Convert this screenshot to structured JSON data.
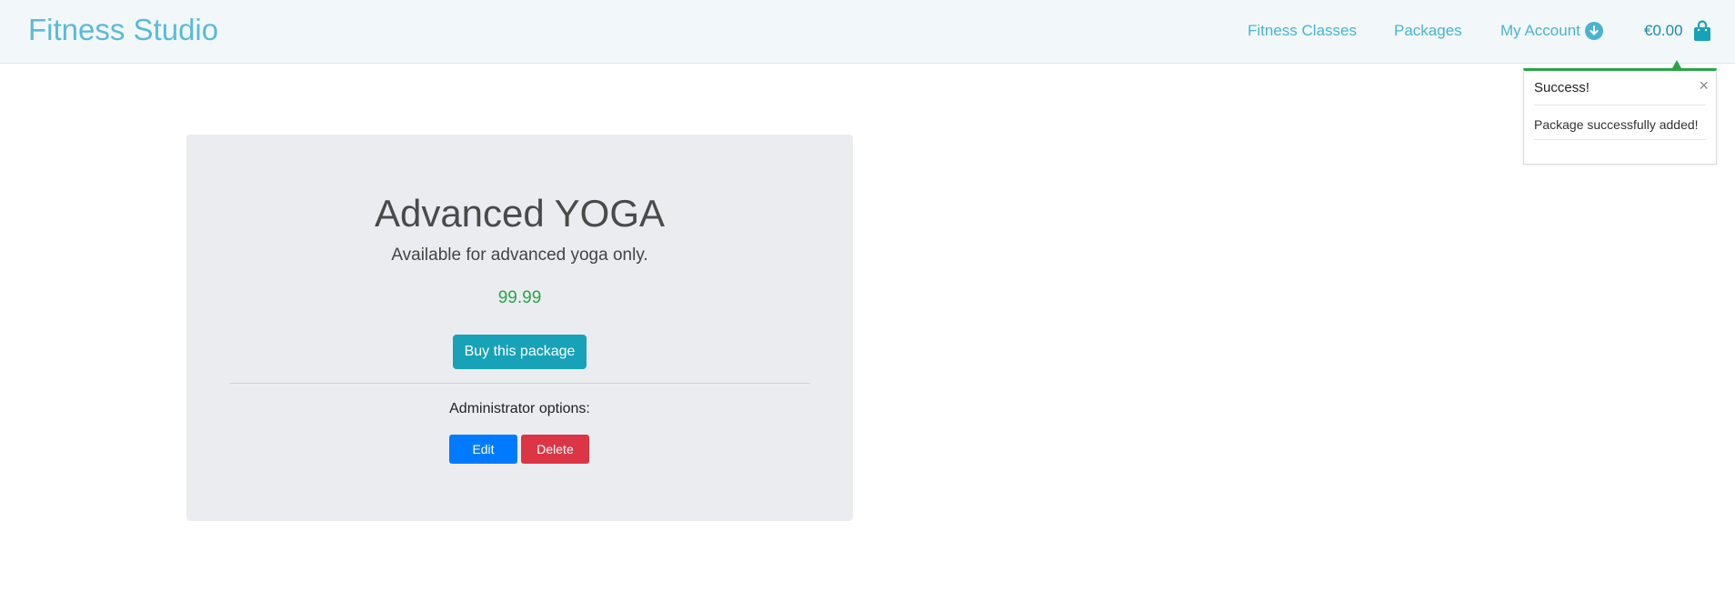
{
  "navbar": {
    "brand": "Fitness Studio",
    "links": {
      "fitness_classes": "Fitness Classes",
      "packages": "Packages",
      "my_account": "My Account"
    },
    "cart_total": "€0.00",
    "icons": {
      "account": "arrow-down-circle-icon",
      "cart": "shopping-bag-icon"
    }
  },
  "toast": {
    "title": "Success!",
    "close": "×",
    "message": "Package successfully added!",
    "accent_color": "#28a745"
  },
  "package": {
    "title": "Advanced YOGA",
    "description": "Available for advanced yoga only.",
    "price": "99.99",
    "buy_label": "Buy this package",
    "admin_label": "Administrator options:",
    "edit_label": "Edit",
    "delete_label": "Delete"
  },
  "colors": {
    "brand": "#5bbad9",
    "price": "#28a745",
    "buy_button": "#17a2b8",
    "edit_button": "#007bff",
    "delete_button": "#dc3545"
  }
}
